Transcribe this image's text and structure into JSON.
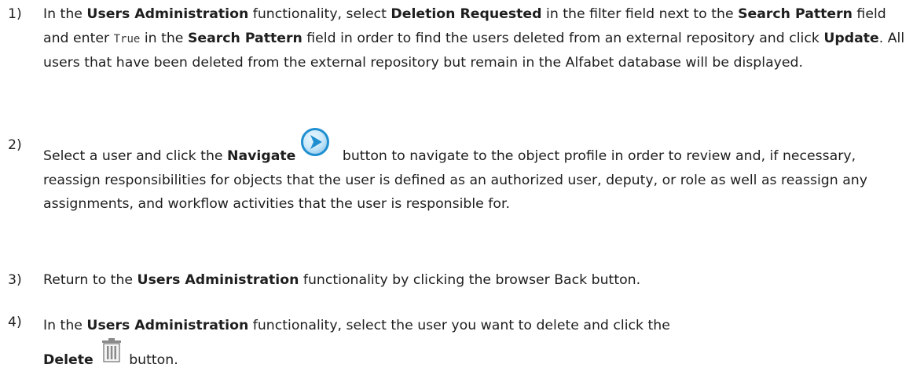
{
  "steps": [
    {
      "number": "1)",
      "parts": {
        "a": "In the ",
        "b1": "Users Administration",
        "c": " functionality, select ",
        "b2": "Deletion Requested",
        "d": " in the filter field next to the ",
        "b3": "Search Pattern",
        "e": " field and enter ",
        "code": "True",
        "f": " in the ",
        "b4": "Search Pattern",
        "g": " field in order to find the users deleted from an external repository and click ",
        "b5": "Update",
        "h": ". All users that have been deleted from the external repository but remain in the Alfabet database will be displayed."
      }
    },
    {
      "number": "2)",
      "parts": {
        "a": "Select a user and click the ",
        "b1": "Navigate",
        "icon": "navigate-arrow-icon",
        "c": " button to navigate to the object profile in order to review and, if necessary, reassign responsibilities for objects that the user is defined as an authorized user, deputy, or role as well as reassign any assignments, and workflow activities that the user is responsible for."
      }
    },
    {
      "number": "3)",
      "parts": {
        "a": "Return to the ",
        "b1": "Users Administration",
        "c": " functionality by clicking the browser Back button."
      }
    },
    {
      "number": "4)",
      "parts": {
        "a": "In the ",
        "b1": "Users Administration",
        "c": " functionality, select the user you want to delete and click the",
        "b2": "Delete",
        "icon": "trash-can-icon",
        "d": " button."
      }
    }
  ],
  "colors": {
    "text": "#1e1e1e",
    "navigate_icon": "#1f8fd0",
    "trash_icon": "#8a8a8a"
  }
}
